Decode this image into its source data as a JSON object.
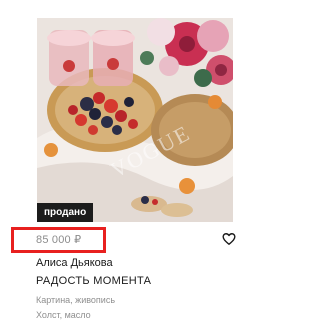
{
  "product": {
    "badge": "продано",
    "price": "85 000 ₽",
    "artist": "Алиса Дьякова",
    "title": "РАДОСТЬ МОМЕНТА",
    "category": "Картина, живопись",
    "medium": "Холст, масло",
    "watermark": "VOGUE",
    "favorite_icon": "heart-icon",
    "highlight_color": "#e8201f"
  }
}
